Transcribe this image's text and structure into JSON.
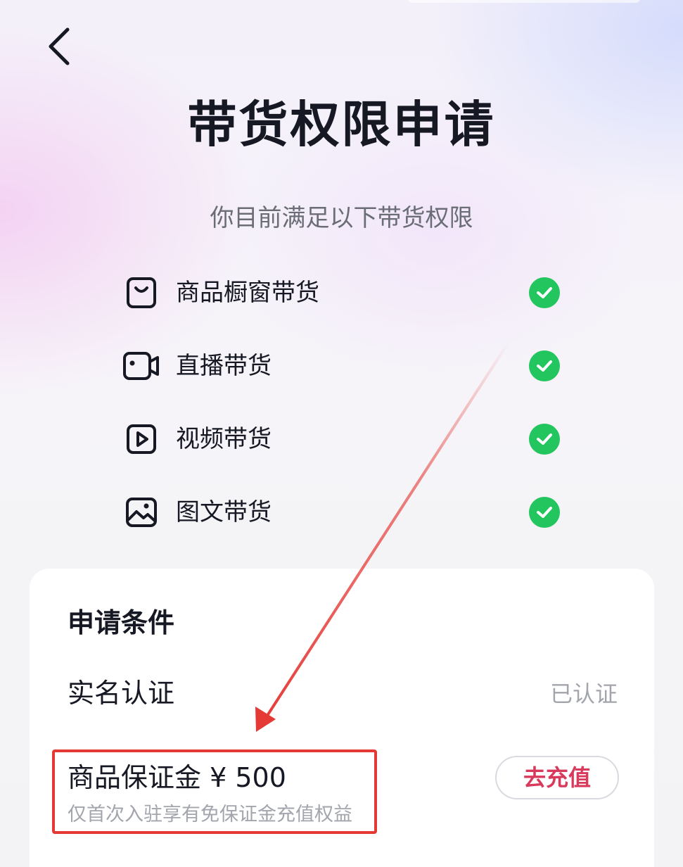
{
  "header": {
    "title": "带货权限申请",
    "subtitle": "你目前满足以下带货权限"
  },
  "permissions": [
    {
      "label": "商品橱窗带货",
      "icon": "shopping-bag-icon",
      "status": "satisfied"
    },
    {
      "label": "直播带货",
      "icon": "video-camera-icon",
      "status": "satisfied"
    },
    {
      "label": "视频带货",
      "icon": "video-play-icon",
      "status": "satisfied"
    },
    {
      "label": "图文带货",
      "icon": "image-icon",
      "status": "satisfied"
    }
  ],
  "conditions": {
    "title": "申请条件",
    "real_name": {
      "label": "实名认证",
      "status": "已认证"
    },
    "deposit": {
      "label": "商品保证金 ¥ 500",
      "note": "仅首次入驻享有免保证金充值权益",
      "button_label": "去充值"
    }
  },
  "colors": {
    "check_green": "#22c55e",
    "accent_red": "#d83a5c",
    "annotation_red": "#e53935"
  }
}
